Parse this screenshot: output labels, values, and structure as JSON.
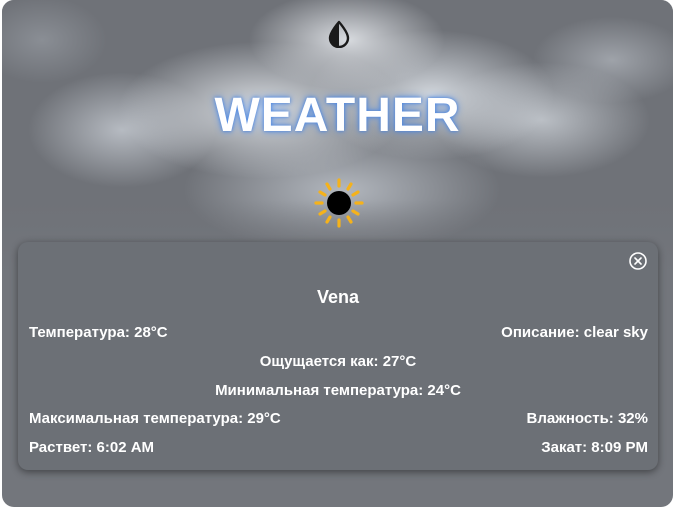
{
  "app": {
    "title": "WEATHER",
    "theme_toggle_icon": "contrast-drop-icon",
    "condition_icon": "sun-icon",
    "background": "clouds"
  },
  "card": {
    "close_icon": "close-circle-icon",
    "city": "Vena",
    "temperature": "Температура: 28°C",
    "description": "Описание: clear sky",
    "feels_like": "Ощущается как: 27°C",
    "min_temperature": "Минимальная температура: 24°C",
    "max_temperature": "Максимальная температура: 29°C",
    "humidity": "Влажность: 32%",
    "sunrise": "Раствет: 6:02 AM",
    "sunset": "Закат: 8:09 PM"
  },
  "colors": {
    "title_glow": "#4f8ee6",
    "sun_rays": "#f5b21b",
    "card_bg": "#6c7076"
  }
}
